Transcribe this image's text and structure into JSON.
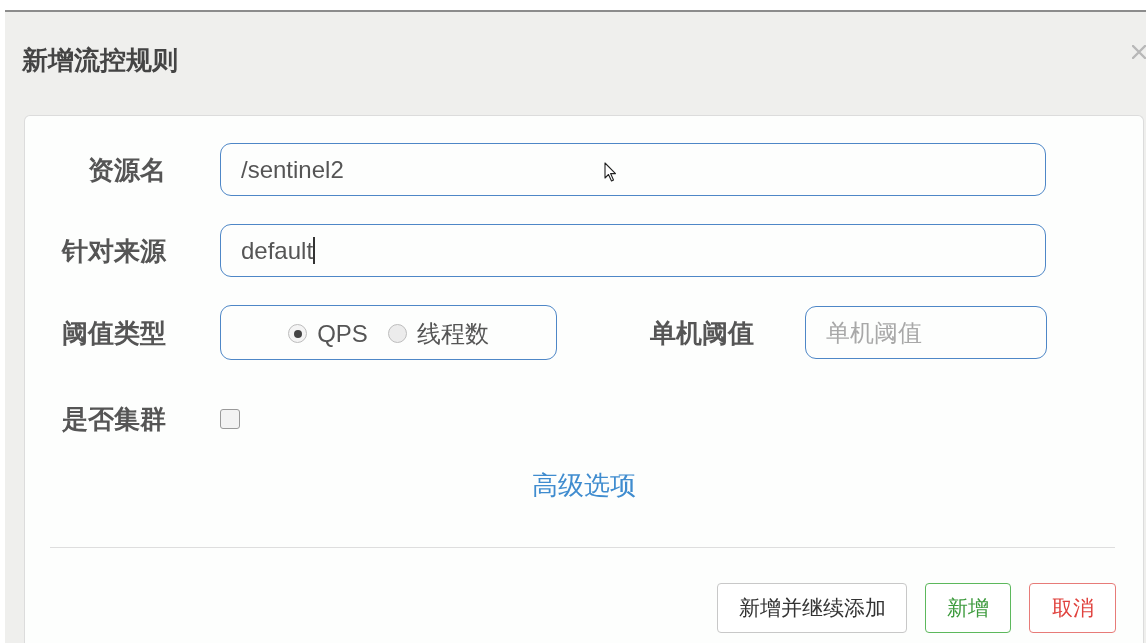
{
  "dialog": {
    "title": "新增流控规则"
  },
  "rows": [
    {
      "fields": [
        {
          "kind": "text",
          "label": "资源名",
          "value": "/sentinel2"
        }
      ]
    },
    {
      "fields": [
        {
          "kind": "text",
          "label": "针对来源",
          "value": "default",
          "caret": true
        }
      ]
    },
    {
      "fields": [
        {
          "kind": "radio_group",
          "label": "阈值类型",
          "options": [
            {
              "label": "QPS",
              "selected": true
            },
            {
              "label": "线程数",
              "selected": false
            }
          ]
        },
        {
          "kind": "text",
          "label": "单机阈值",
          "placeholder": "单机阈值"
        }
      ]
    },
    {
      "fields": [
        {
          "kind": "checkbox",
          "label": "是否集群",
          "checked": false
        }
      ]
    }
  ],
  "advanced_link": "高级选项",
  "buttons": [
    {
      "label": "新增并继续添加",
      "kind": "default"
    },
    {
      "label": "新增",
      "kind": "success"
    },
    {
      "label": "取消",
      "kind": "danger"
    }
  ]
}
